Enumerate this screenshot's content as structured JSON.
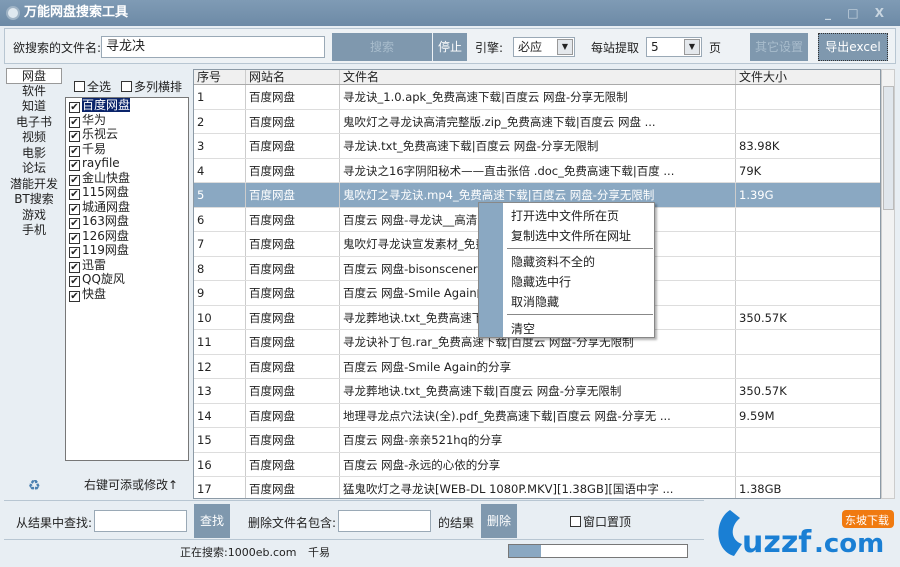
{
  "window": {
    "title": "万能网盘搜索工具",
    "controls": [
      "_",
      "□",
      "X"
    ]
  },
  "toolbar": {
    "search_label": "欲搜索的文件名:",
    "search_value": "寻龙决",
    "search_button": "搜索",
    "stop_button": "停止",
    "engine_label": "引擎:",
    "engine_value": "必应",
    "per_site_label": "每站提取",
    "per_site_value": "5",
    "page_unit": "页",
    "other_settings": "其它设置",
    "export_button": "导出excel"
  },
  "categories": {
    "items": [
      "网盘",
      "软件",
      "知道",
      "电子书",
      "视频",
      "电影",
      "论坛",
      "潜能开发",
      "BT搜索",
      "游戏",
      "手机"
    ],
    "active": "网盘"
  },
  "site_options": {
    "select_all": "全选",
    "multi_column": "多列横排",
    "hint": "右键可添或修改↑"
  },
  "sites": [
    {
      "name": "百度网盘",
      "checked": true,
      "selected": true
    },
    {
      "name": "华为",
      "checked": true
    },
    {
      "name": "乐视云",
      "checked": true
    },
    {
      "name": "千易",
      "checked": true
    },
    {
      "name": "rayfile",
      "checked": true
    },
    {
      "name": "金山快盘",
      "checked": true
    },
    {
      "name": "115网盘",
      "checked": true
    },
    {
      "name": "城通网盘",
      "checked": true
    },
    {
      "name": "163网盘",
      "checked": true
    },
    {
      "name": "126网盘",
      "checked": true
    },
    {
      "name": "119网盘",
      "checked": true
    },
    {
      "name": "迅雷",
      "checked": true
    },
    {
      "name": "QQ旋风",
      "checked": true
    },
    {
      "name": "快盘",
      "checked": true
    }
  ],
  "table": {
    "columns": [
      "序号",
      "网站名",
      "文件名",
      "文件大小"
    ],
    "rows": [
      [
        "1",
        "百度网盘",
        "寻龙诀_1.0.apk_免费高速下载|百度云 网盘-分享无限制",
        ""
      ],
      [
        "2",
        "百度网盘",
        "鬼吹灯之寻龙诀高清完整版.zip_免费高速下载|百度云 网盘 ...",
        ""
      ],
      [
        "3",
        "百度网盘",
        "寻龙诀.txt_免费高速下载|百度云 网盘-分享无限制",
        "83.98K"
      ],
      [
        "4",
        "百度网盘",
        "寻龙诀之16字阴阳秘术——直击张倍 .doc_免费高速下载|百度 ...",
        "79K"
      ],
      [
        "5",
        "百度网盘",
        "鬼吹灯之寻龙诀.mp4_免费高速下载|百度云 网盘-分享无限制",
        "1.39G"
      ],
      [
        "6",
        "百度网盘",
        "百度云 网盘-寻龙诀__高清",
        ""
      ],
      [
        "7",
        "百度网盘",
        "鬼吹灯寻龙诀宣发素材_免费",
        ""
      ],
      [
        "8",
        "百度网盘",
        "百度云 网盘-bisonscenery",
        ""
      ],
      [
        "9",
        "百度网盘",
        "百度云 网盘-Smile Again的",
        ""
      ],
      [
        "10",
        "百度网盘",
        "寻龙葬地诀.txt_免费高速下",
        "350.57K"
      ],
      [
        "11",
        "百度网盘",
        "寻龙诀补丁包.rar_免费高速下载|百度云 网盘-分享无限制",
        ""
      ],
      [
        "12",
        "百度网盘",
        "百度云 网盘-Smile Again的分享",
        ""
      ],
      [
        "13",
        "百度网盘",
        "寻龙葬地诀.txt_免费高速下载|百度云 网盘-分享无限制",
        "350.57K"
      ],
      [
        "14",
        "百度网盘",
        "地理寻龙点穴法诀(全).pdf_免费高速下载|百度云 网盘-分享无 ...",
        "9.59M"
      ],
      [
        "15",
        "百度网盘",
        "百度云 网盘-亲亲521hq的分享",
        ""
      ],
      [
        "16",
        "百度网盘",
        "百度云 网盘-永远的心依的分享",
        ""
      ],
      [
        "17",
        "百度网盘",
        "猛鬼吹灯之寻龙诀[WEB-DL 1080P.MKV][1.38GB][国语中字 ...",
        "1.38GB"
      ]
    ],
    "selected_row": "5"
  },
  "context_menu": {
    "items": [
      "打开选中文件所在页",
      "复制选中文件所在网址",
      "隐藏资料不全的",
      "隐藏选中行",
      "取消隐藏",
      "清空"
    ]
  },
  "bottom": {
    "find_label": "从结果中查找:",
    "find_value": "",
    "find_button": "查找",
    "delete_label": "删除文件名包含:",
    "delete_value": "",
    "delete_suffix": "的结果",
    "delete_button": "删除",
    "topmost_label": "窗口置顶"
  },
  "status": {
    "searching_label": "正在搜索:1000eb.com",
    "current_site": "千易",
    "progress_percent": 18
  },
  "brand": {
    "logo_text": "uzzf.com",
    "logo_sub": "东坡下载"
  },
  "colors": {
    "accent": "#7f98ae",
    "selection": "#8aa8c2",
    "titlebar": "#7391ad"
  }
}
